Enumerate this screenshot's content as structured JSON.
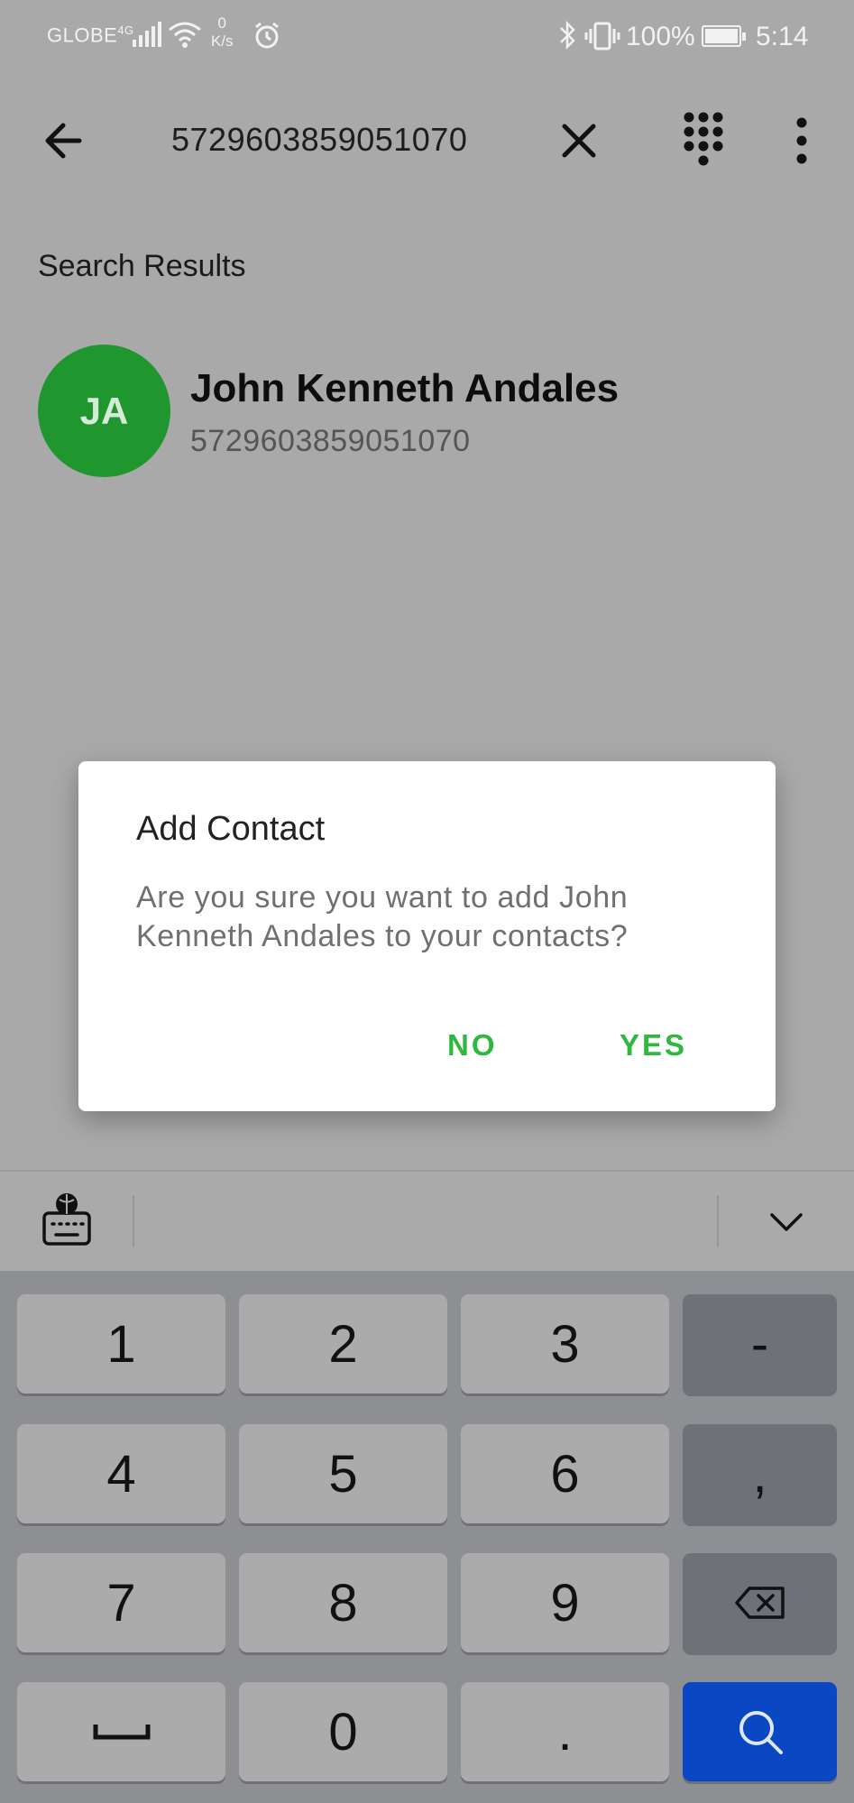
{
  "status_bar": {
    "carrier": "GLOBE",
    "network_type": "4G",
    "net_speed_value": "0",
    "net_speed_unit": "K/s",
    "battery_percent": "100%",
    "time": "5:14",
    "icons": [
      "signal-icon",
      "wifi-icon",
      "alarm-icon",
      "bluetooth-icon",
      "vibrate-icon",
      "battery-icon"
    ]
  },
  "app_bar": {
    "search_value": "5729603859051070",
    "icons": [
      "back-arrow-icon",
      "close-icon",
      "dialpad-icon",
      "more-vert-icon"
    ]
  },
  "results": {
    "heading": "Search Results",
    "items": [
      {
        "initials": "JA",
        "name": "John Kenneth Andales",
        "number": "5729603859051070",
        "avatar_color": "#20962e"
      }
    ]
  },
  "dialog": {
    "title": "Add Contact",
    "message": "Are you sure you want to add John Kenneth Andales to your contacts?",
    "no_label": "NO",
    "yes_label": "YES",
    "accent_color": "#2eb83f"
  },
  "keyboard": {
    "toolbar_icons": [
      "keyboard-settings-icon",
      "chevron-down-icon"
    ],
    "keys": {
      "k1": "1",
      "k2": "2",
      "k3": "3",
      "dash": "-",
      "k4": "4",
      "k5": "5",
      "k6": "6",
      "comma": ",",
      "k7": "7",
      "k8": "8",
      "k9": "9",
      "k0": "0",
      "dot": "."
    },
    "search_key_color": "#0a47c2"
  }
}
